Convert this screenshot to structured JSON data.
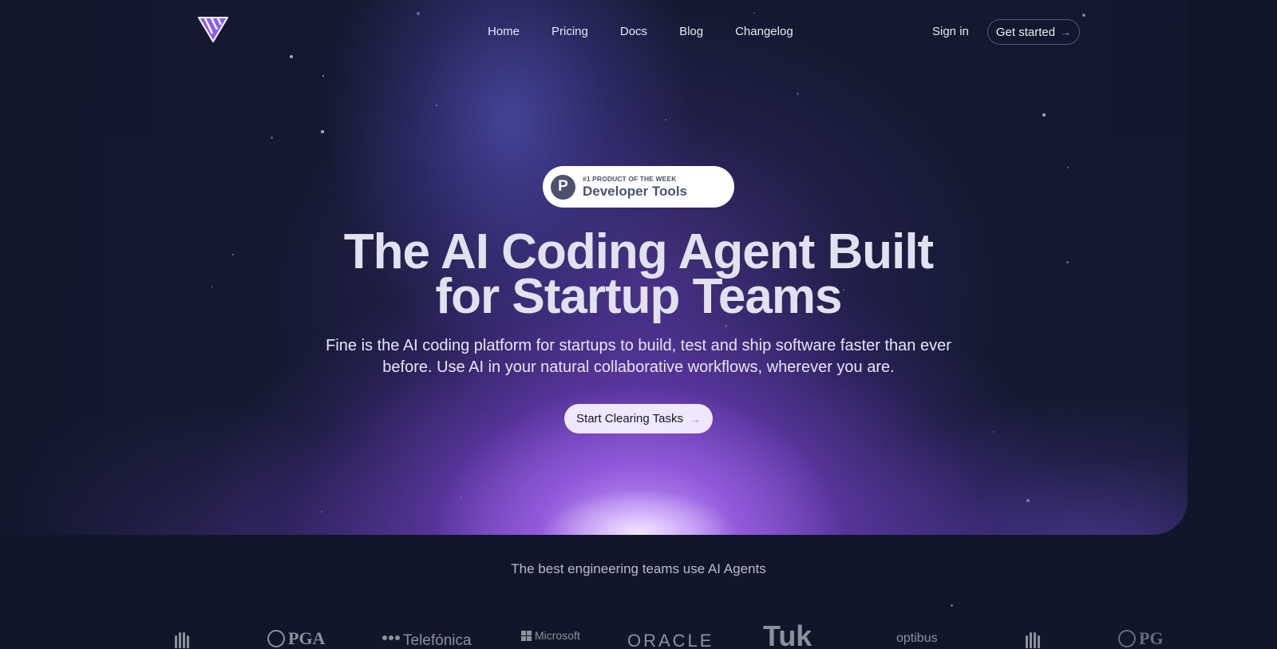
{
  "nav": {
    "logo": "brand-logo",
    "links": [
      "Home",
      "Pricing",
      "Docs",
      "Blog",
      "Changelog"
    ],
    "sign_in": "Sign in",
    "get_started": "Get started",
    "arrow": "→"
  },
  "badge": {
    "icon_letter": "P",
    "small": "#1 PRODUCT OF THE WEEK",
    "big": "Developer Tools"
  },
  "hero": {
    "headline_line1": "The AI Coding Agent Built",
    "headline_line2": "for Startup Teams",
    "subtitle_line1": "Fine is the AI coding platform for startups to build, test and ship software faster than ever",
    "subtitle_line2": "before. Use AI in your natural collaborative workflows, wherever you are.",
    "cta_label": "Start Clearing Tasks",
    "cta_arrow": "→"
  },
  "tagline": "The best engineering teams use AI Agents",
  "customer_logos": [
    {
      "name": "bars-logo",
      "text": ""
    },
    {
      "name": "pga",
      "text": "PGA"
    },
    {
      "name": "telefonica",
      "text": "Telefónica"
    },
    {
      "name": "microsoft",
      "text": "Microsoft"
    },
    {
      "name": "oracle",
      "text": "ORACLE"
    },
    {
      "name": "tuk",
      "text": "Tuk"
    },
    {
      "name": "optibus",
      "text": "optibus"
    },
    {
      "name": "bars-logo",
      "text": ""
    },
    {
      "name": "pga",
      "text": "PG"
    }
  ],
  "colors": {
    "background": "#11172a",
    "accent": "#a77bf3",
    "badge_text": "#4b5170"
  }
}
